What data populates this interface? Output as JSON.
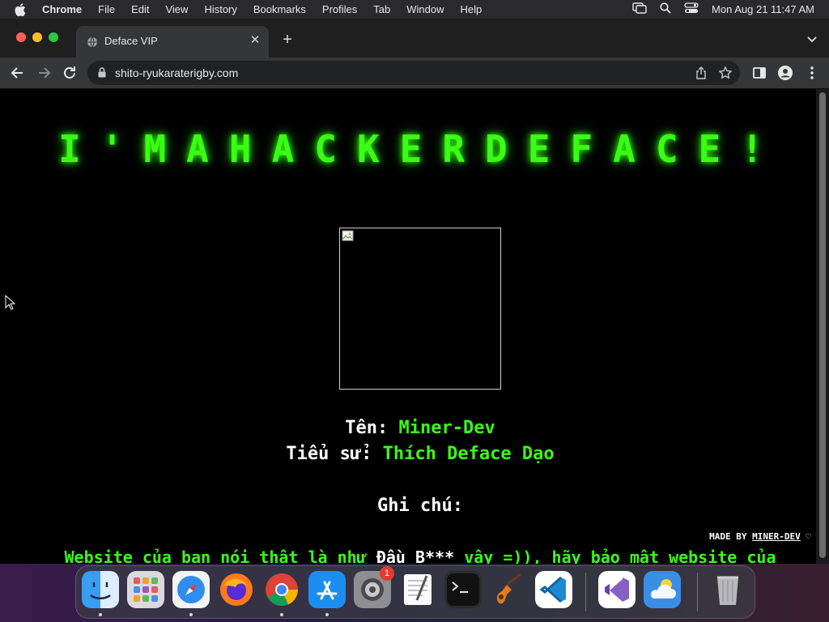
{
  "menubar": {
    "items": [
      "Chrome",
      "File",
      "Edit",
      "View",
      "History",
      "Bookmarks",
      "Profiles",
      "Tab",
      "Window",
      "Help"
    ],
    "clock": "Mon Aug 21  11:47 AM"
  },
  "tab": {
    "title": "Deface VIP",
    "close_glyph": "✕",
    "new_tab_glyph": "+"
  },
  "address": {
    "url": "shito-ryukaraterigby.com"
  },
  "page": {
    "title": "I'MAHACKERDEFACE!",
    "name_label": "Tên:",
    "name_value": "Miner-Dev",
    "bio_label": "Tiểu sử:",
    "bio_value": "Thích Deface Dạo",
    "note_label": "Ghi chú:",
    "made_by_prefix": "MADE BY",
    "made_by_name": "MINER-DEV",
    "made_by_heart": "♡",
    "message_start": "Website của bạn nói thật là như",
    "message_mid": "Đầu B***",
    "message_end": "vậy =)), hãy bảo mật website của"
  },
  "dock": {
    "apps": [
      "finder-icon",
      "launchpad-icon",
      "safari-icon",
      "firefox-icon",
      "chrome-icon",
      "app-store-icon",
      "system-settings-icon",
      "textedit-icon",
      "terminal-icon",
      "garageband-icon",
      "vscode-icon",
      "visual-studio-icon",
      "weather-icon",
      "trash-icon"
    ],
    "settings_badge": "1"
  },
  "colors": {
    "hacker_green": "#39ff14",
    "page_bg": "#000000",
    "chrome_tab": "#35363a"
  }
}
